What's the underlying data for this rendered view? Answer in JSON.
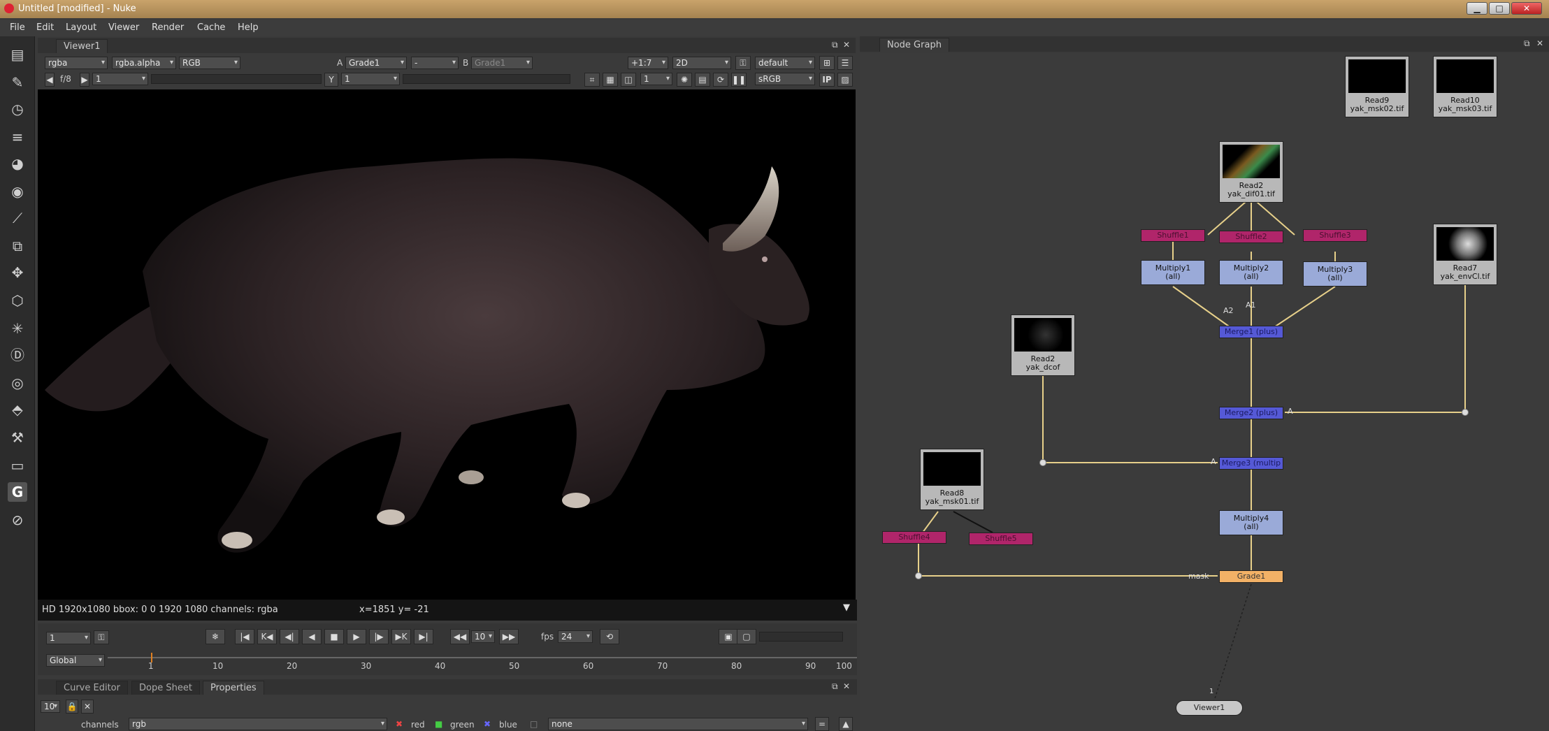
{
  "window": {
    "title": "Untitled [modified] - Nuke",
    "buttons": {
      "minimize": "▁",
      "maximize": "□",
      "close": "✕"
    }
  },
  "menu": [
    "File",
    "Edit",
    "Layout",
    "Viewer",
    "Render",
    "Cache",
    "Help"
  ],
  "toolbar_icons": [
    "image-icon",
    "draw-icon",
    "time-icon",
    "channel-icon",
    "color-icon",
    "filter-icon",
    "keyer-icon",
    "merge-icon",
    "transform-icon",
    "3d-icon",
    "particles-icon",
    "deep-icon",
    "views-icon",
    "metadata-icon",
    "toolsets-icon",
    "other-icon",
    "gizmo-icon",
    "plugin-icon"
  ],
  "toolbar_gizmo_label": "G",
  "viewer": {
    "tab": "Viewer1",
    "channels": "rgba",
    "alpha": "rgba.alpha",
    "display": "RGB",
    "a_label": "A",
    "a_input": "Grade1",
    "wipe": "-",
    "b_label": "B",
    "b_input": "Grade1",
    "zoom": "+1:7",
    "view_mode": "2D",
    "lut_default": "default",
    "fstop": "f/8",
    "gain": "1",
    "y_label": "Y",
    "gamma": "1",
    "proxy": "1",
    "colorspace": "sRGB",
    "ip": "IP",
    "info": "HD 1920x1080 bbox: 0 0 1920 1080 channels: rgba",
    "coords": "x=1851 y= -21"
  },
  "transport": {
    "frame": "1",
    "increment": "10",
    "fps_label": "fps",
    "fps": "24",
    "range_mode": "Global",
    "ticks": [
      "1",
      "10",
      "20",
      "30",
      "40",
      "50",
      "60",
      "70",
      "80",
      "90",
      "100"
    ]
  },
  "bottom_panel": {
    "tabs": [
      "Curve Editor",
      "Dope Sheet",
      "Properties"
    ],
    "max_panels": "10",
    "channels_label": "channels",
    "channels_value": "rgb",
    "red": "red",
    "green": "green",
    "blue": "blue",
    "mask": "none"
  },
  "node_graph": {
    "tab": "Node Graph",
    "read_nodes": [
      {
        "name": "Read9",
        "file": "yak_msk02.tif"
      },
      {
        "name": "Read10",
        "file": "yak_msk03.tif"
      },
      {
        "name": "Read2",
        "file": "yak_dif01.tif"
      },
      {
        "name": "Read7",
        "file": "yak_envCl.tif"
      },
      {
        "name": "Read2",
        "file": "yak_dcof"
      },
      {
        "name": "Read8",
        "file": "yak_msk01.tif"
      }
    ],
    "shuffles": [
      "Shuffle1",
      "Shuffle2",
      "Shuffle3",
      "Shuffle4",
      "Shuffle5"
    ],
    "multiplies": [
      {
        "name": "Multiply1",
        "sub": "(all)"
      },
      {
        "name": "Multiply2",
        "sub": "(all)"
      },
      {
        "name": "Multiply3",
        "sub": "(all)"
      },
      {
        "name": "Multiply4",
        "sub": "(all)"
      }
    ],
    "merges": [
      "Merge1 (plus)",
      "Merge2 (plus)",
      "Merge3 (multip"
    ],
    "pipe_labels": {
      "a2": "A2",
      "a1": "A1",
      "a_merge2": "A",
      "a_merge3": "A",
      "mask": "mask"
    },
    "grade": "Grade1",
    "viewer_node": "Viewer1",
    "viewer_input": "1"
  },
  "colors": {
    "shuffle": "#b0256a",
    "multiply": "#9aaad8",
    "merge": "#5559d6",
    "grade": "#f2b166",
    "pipe": "#e7d08a",
    "playhead": "#e08020"
  }
}
